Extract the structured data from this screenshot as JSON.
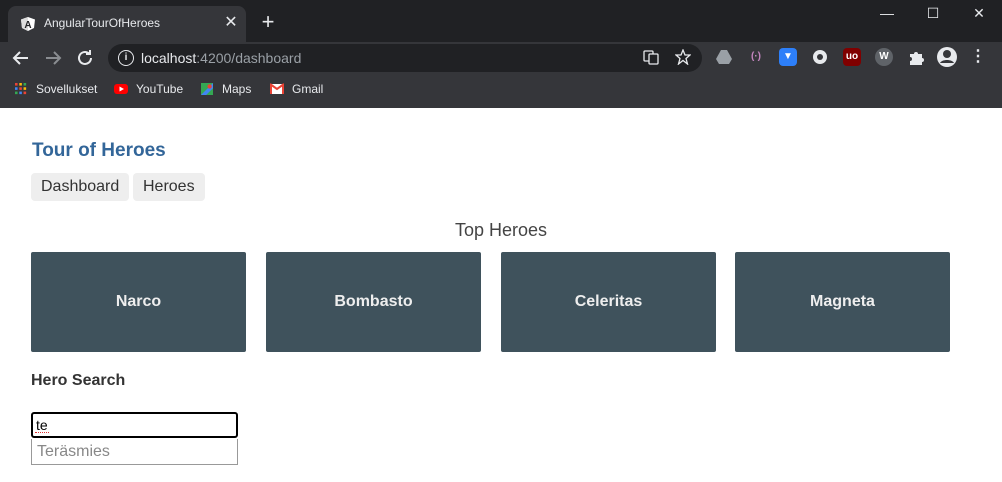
{
  "browser": {
    "tab_title": "AngularTourOfHeroes",
    "tab_close": "✕",
    "new_tab": "+",
    "url_host": "localhost",
    "url_rest": ":4200/dashboard",
    "window": {
      "minimize": "—",
      "maximize": "☐",
      "close": "✕"
    },
    "bookmarks": [
      {
        "label": "Sovellukset",
        "icon": "apps-grid-icon"
      },
      {
        "label": "YouTube",
        "icon": "youtube-icon"
      },
      {
        "label": "Maps",
        "icon": "maps-icon"
      },
      {
        "label": "Gmail",
        "icon": "gmail-icon"
      }
    ]
  },
  "app": {
    "title": "Tour of Heroes",
    "nav": {
      "dashboard": "Dashboard",
      "heroes": "Heroes"
    },
    "top_heroes_title": "Top Heroes",
    "heroes": [
      "Narco",
      "Bombasto",
      "Celeritas",
      "Magneta"
    ],
    "search": {
      "label": "Hero Search",
      "value": "te",
      "results": [
        "Teräsmies"
      ]
    }
  },
  "colors": {
    "title": "#336699",
    "hero_card": "#3f525c",
    "nav_bg": "#eeeeee"
  }
}
